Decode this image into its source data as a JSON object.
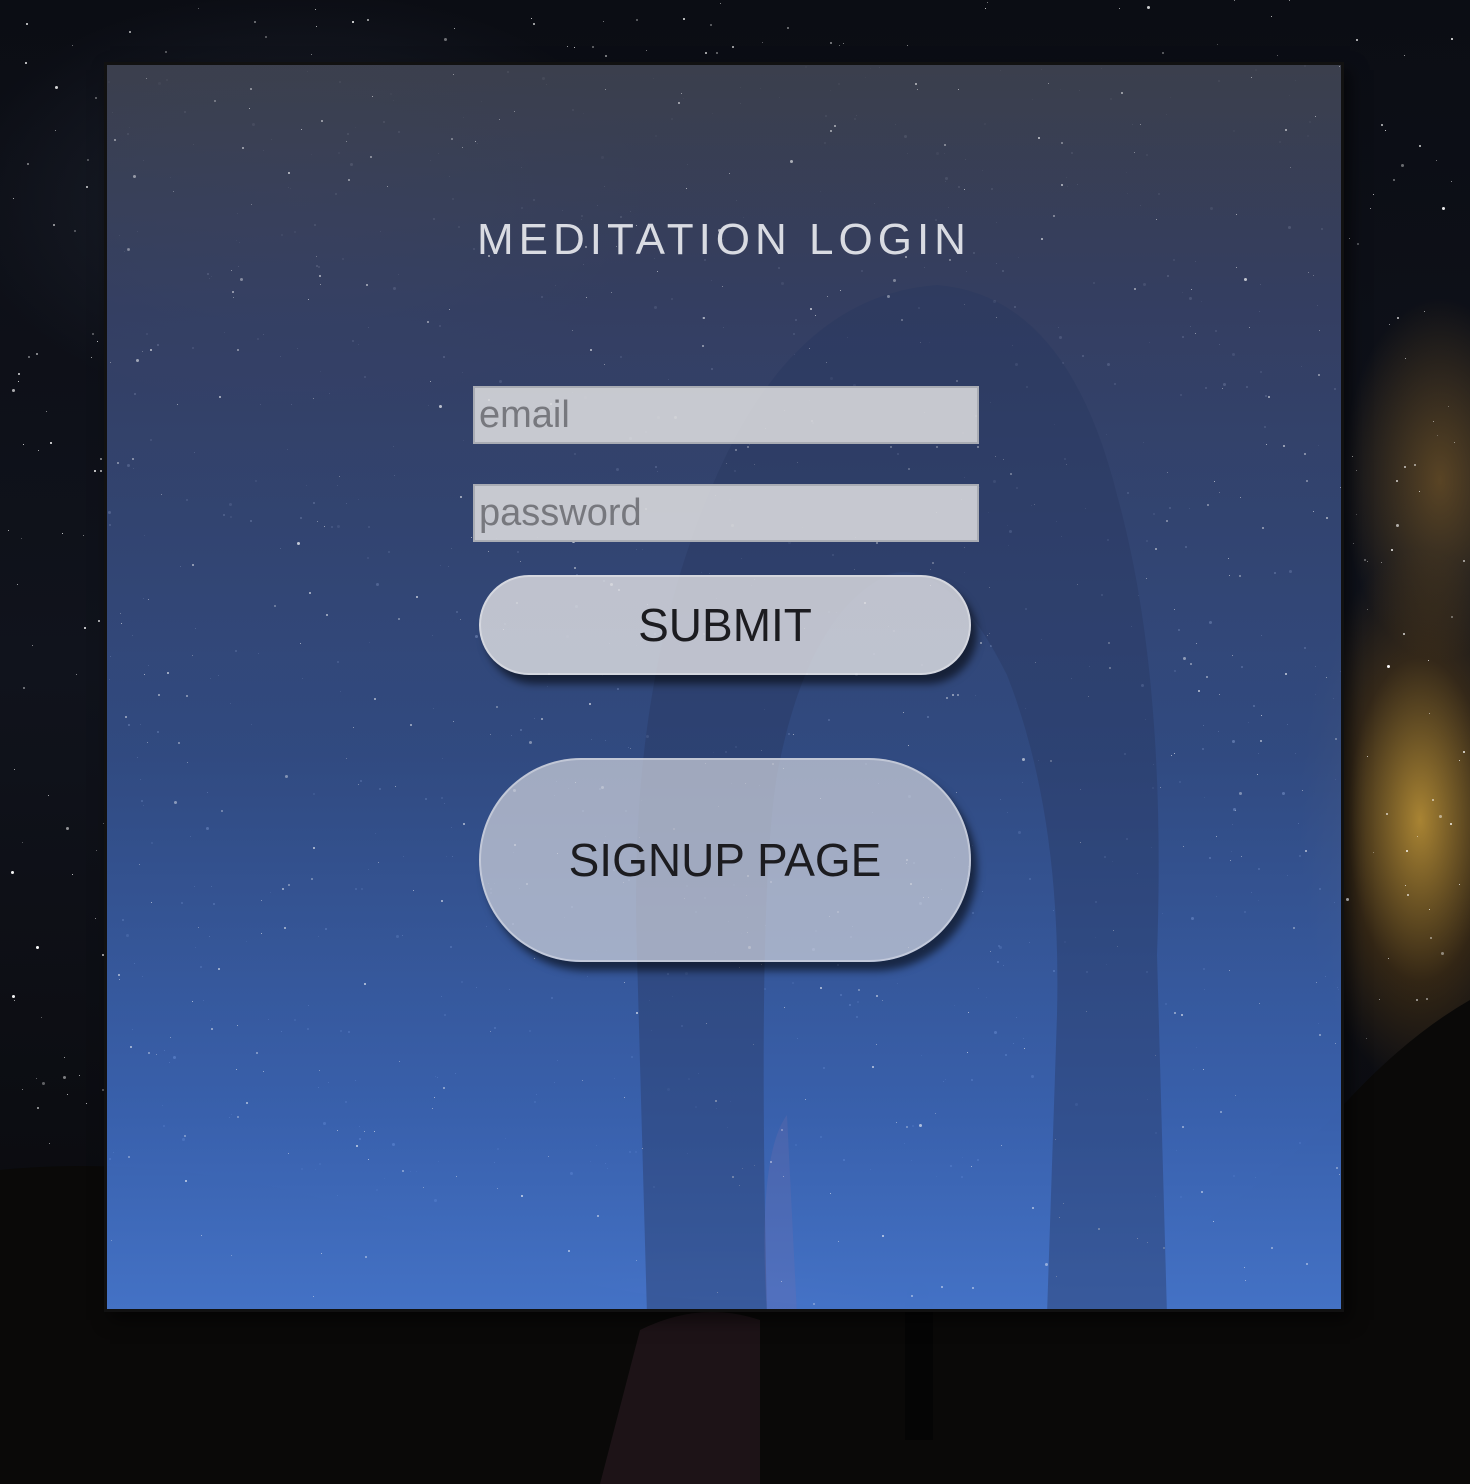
{
  "page": {
    "title": "MEDITATION LOGIN"
  },
  "form": {
    "email_placeholder": "email",
    "email_value": "",
    "password_placeholder": "password",
    "password_value": "",
    "submit_label": "SUBMIT",
    "signup_label": "SIGNUP PAGE"
  },
  "colors": {
    "panel_top": "#3e4250",
    "panel_bottom": "#4676cd",
    "title_text": "#d9dbe2",
    "button_text": "#1c1c20",
    "input_bg": "#dcdcde"
  },
  "background": {
    "description_icon": "starry-night-arch-background"
  }
}
